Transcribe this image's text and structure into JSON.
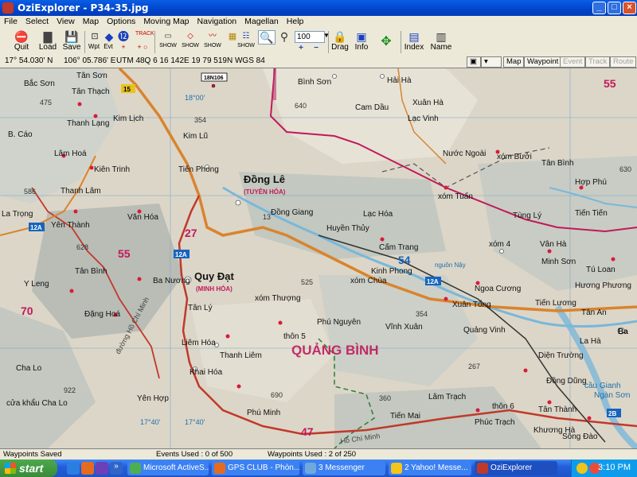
{
  "window": {
    "title": "OziExplorer - P34-35.jpg"
  },
  "menu": [
    "File",
    "Select",
    "View",
    "Map",
    "Options",
    "Moving Map",
    "Navigation",
    "Magellan",
    "Help"
  ],
  "toolbar": {
    "quit": "Quit",
    "load": "Load",
    "save": "Save",
    "wpt": "Wpt",
    "evt": "Evt",
    "track": "TRACK",
    "show": "SHOW",
    "zoom": "100",
    "drag": "Drag",
    "info": "Info",
    "index": "Index",
    "name": "Name"
  },
  "coords": {
    "lat": "17° 54.030' N",
    "lon": "106° 05.786' E",
    "utm": "UTM 48Q  6 16 142E  19 79 519N  WGS 84"
  },
  "coord_buttons": {
    "map": "Map",
    "waypoint": "Waypoint",
    "event": "Event",
    "track": "Track",
    "route": "Route"
  },
  "map_labels": {
    "grid_ref": "18N106",
    "tan_son": "Tân Sơn",
    "bac_son": "Bắc Sơn",
    "tan_thach": "Tân Thạch",
    "thanh_lang": "Thanh Lạng",
    "kim_lich": "Kim Lịch",
    "b_cao": "B. Cáo",
    "lam_hoa": "Lâm Hoá",
    "kien_trinh": "Kiên Trinh",
    "thanh_lam": "Thanh Lâm",
    "la_trong": "La Trọng",
    "yen_thanh": "Yên Thành",
    "tan_binh_w": "Tân Bình",
    "y_leng": "Y Leng",
    "dang_hoa": "Đặng Hoá",
    "cha_lo": "Cha Lo",
    "cua_khau": "cửa khẩu Cha Lo",
    "yen_hop": "Yên Hợp",
    "khai_hoa": "Khai Hóa",
    "liem_hoa": "Liêm Hóa",
    "thanh_liem": "Thanh Liêm",
    "phu_minh": "Phú Minh",
    "tien_phong": "Tiến Phong",
    "kim_lu": "Kim Lũ",
    "dong_le": "Đồng Lê",
    "tuyen_hoa": "(TUYÊN HÓA)",
    "van_hoa": "Văn Hóa",
    "quy_dat": "Quy Đạt",
    "minh_hoa": "(MINH HÓA)",
    "ba_nuong": "Ba Nương",
    "tan_ly": "Tân Lý",
    "xom_thuong": "xóm Thượng",
    "thon_5": "thôn 5",
    "dong_giang": "Đồng Giang",
    "huyen_thuy": "Huyền Thủy",
    "lac_hoa": "Lạc Hóa",
    "cam_trang": "Cấm Trang",
    "binh_son": "Bình Sơn",
    "hai_ha": "Hải Hà",
    "cam_dau": "Cam Dầu",
    "xuan_ha": "Xuân Hà",
    "lac_vinh": "Lạc Vinh",
    "nuoc_ngoai": "Nước Ngoài",
    "xom_tuan": "xóm Tuấn",
    "xom_buoi": "xóm Bưởi",
    "tan_binh_e": "Tân Bình",
    "hop_phu": "Hợp Phú",
    "tung_ly": "Tùng Lý",
    "tien_tien": "Tiến Tiến",
    "xom_4": "xóm 4",
    "van_ha": "Vân Hà",
    "minh_son": "Minh Sơn",
    "tu_loan": "Tú Loan",
    "huong_phuong": "Hương Phương",
    "ngoa_cuong": "Ngoa Cương",
    "tien_luong": "Tiến Lương",
    "tan_an": "Tân An",
    "kinh_phong": "Kinh Phong",
    "xom_chua": "xóm Chùa",
    "xuan_tong": "Xuân Tổng",
    "phu_nguyen": "Phú Nguyên",
    "vinh_xuan": "Vĩnh Xuân",
    "quang_binh": "QUẢNG BÌNH",
    "quang_vinh": "Quảng Vinh",
    "dien_truong": "Diện Trường",
    "la_ha": "La Hà",
    "ba_don": "Ba",
    "dong_dung": "Đồng Dũng",
    "lam_trach": "Lâm Trạch",
    "thon_6": "thôn 6",
    "tien_mai": "Tiến Mai",
    "phuc_trach": "Phúc Trạch",
    "tan_thanh": "Tân Thành",
    "song_dao": "Sông Đào",
    "khuong_ha": "Khương Hà",
    "ho_chi_minh": "đường Hồ Chí Minh",
    "hcm_south": "Hồ Chí Minh",
    "cau_gianh": "cầu Gianh",
    "ngan_son": "Ngàn Sơn",
    "nguon_nay": "nguồn Nậy",
    "rt_12a": "12A",
    "rt_15": "15",
    "rt_2b": "2B",
    "rt_13": "13",
    "num_55a": "55",
    "num_55b": "55",
    "num_70": "70",
    "num_27": "27",
    "num_47": "47",
    "num_54": "54",
    "elev_640": "640",
    "elev_354": "354",
    "elev_628": "628",
    "elev_525": "525",
    "elev_586": "586",
    "elev_630": "630",
    "elev_922": "922",
    "elev_690": "690",
    "elev_360": "360",
    "elev_354b": "354",
    "elev_267": "267",
    "elev_475": "475",
    "lat_1800": "18°00'",
    "lon_1740a": "17°40'",
    "lon_1740b": "17°40'"
  },
  "status": {
    "waypoints_saved": "Waypoints Saved",
    "events_used": "Events Used : 0 of 500",
    "waypoints_used": "Waypoints Used : 2 of 250"
  },
  "taskbar": {
    "start": "start",
    "tasks": [
      "Microsoft ActiveS...",
      "GPS CLUB - Phòn...",
      "3 Messenger",
      "2 Yahoo! Messe...",
      "OziExplorer"
    ],
    "clock": "3:10 PM"
  },
  "colors": {
    "road_main": "#d9842e",
    "border": "#c2185b",
    "water": "#7ab7d9",
    "poi": "#d81b3a",
    "region": "#b3386e"
  }
}
